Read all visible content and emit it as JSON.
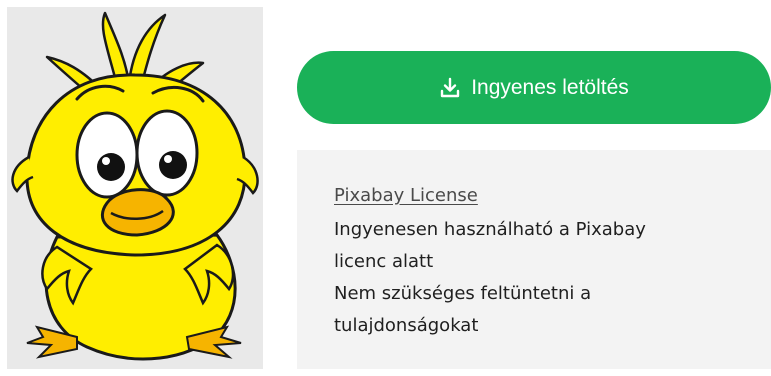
{
  "image": {
    "subject": "cartoon-yellow-chick-icon",
    "colors": {
      "background": "#e9e9e9",
      "chick": "#ffee00",
      "beak": "#f6b400",
      "outline": "#1a1a1a"
    }
  },
  "download_button": {
    "label": "Ingyenes letöltés",
    "icon": "download-icon",
    "color": "#1ab158"
  },
  "license": {
    "link_text": "Pixabay License",
    "lines": [
      "Ingyenesen használható a Pixabay",
      "licenc alatt",
      "Nem szükséges feltüntetni a",
      "tulajdonságokat"
    ],
    "background": "#f3f3f3"
  }
}
